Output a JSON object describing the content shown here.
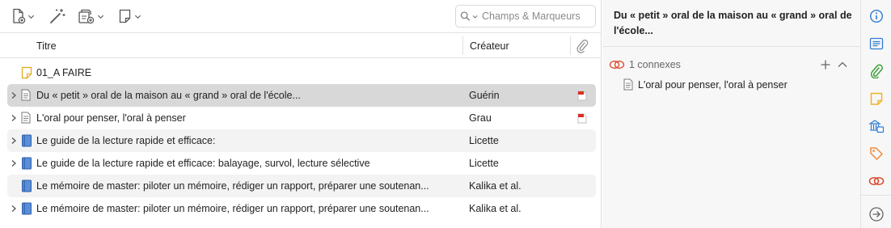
{
  "toolbar": {
    "new_item_icon": "new-item-icon",
    "magic_wand_icon": "add-by-identifier-icon",
    "attachment_icon": "add-attachment-icon",
    "note_icon": "new-note-icon",
    "search": {
      "placeholder": "Champs & Marqueurs",
      "value": ""
    }
  },
  "columns": {
    "title": "Titre",
    "creator": "Créateur",
    "attachment_icon": "paperclip-icon"
  },
  "rows": [
    {
      "title": "01_A FAIRE",
      "creator": "",
      "icon": "note-icon",
      "expandable": false,
      "pdf": false,
      "selected": false,
      "alt": false
    },
    {
      "title": "Du « petit » oral de la maison au « grand » oral de l'école...",
      "creator": "Guérin",
      "icon": "document-icon",
      "expandable": true,
      "pdf": true,
      "selected": true,
      "alt": false
    },
    {
      "title": "L'oral pour penser, l'oral à penser",
      "creator": "Grau",
      "icon": "document-icon",
      "expandable": true,
      "pdf": true,
      "selected": false,
      "alt": false
    },
    {
      "title": "Le guide de la lecture rapide et efficace:",
      "creator": "Licette",
      "icon": "book-icon",
      "expandable": true,
      "pdf": false,
      "selected": false,
      "alt": true
    },
    {
      "title": "Le guide de la lecture rapide et efficace: balayage, survol, lecture sélective",
      "creator": "Licette",
      "icon": "book-icon",
      "expandable": true,
      "pdf": false,
      "selected": false,
      "alt": false
    },
    {
      "title": "Le mémoire de master: piloter un mémoire, rédiger un rapport, préparer une soutenan...",
      "creator": "Kalika et al.",
      "icon": "book-icon",
      "expandable": false,
      "pdf": false,
      "selected": false,
      "alt": true
    },
    {
      "title": "Le mémoire de master: piloter un mémoire, rédiger un rapport, préparer une soutenan...",
      "creator": "Kalika et al.",
      "icon": "book-icon",
      "expandable": true,
      "pdf": false,
      "selected": false,
      "alt": false
    }
  ],
  "item_pane": {
    "title": "Du « petit » oral de la maison au « grand » oral de l'école...",
    "related": {
      "count_label": "1 connexes",
      "items": [
        {
          "title": "L'oral pour penser, l'oral à penser"
        }
      ]
    }
  },
  "sidebar": {
    "icons": [
      "info-icon",
      "abstract-icon",
      "attachments-icon",
      "notes-icon",
      "libraries-collections-icon",
      "tags-icon",
      "related-icon",
      "locate-icon"
    ]
  },
  "colors": {
    "accent_blue": "#2e7bd6",
    "attachment_green": "#3aa13a",
    "note_yellow": "#f0b429",
    "tag_orange": "#f08a3c",
    "related_red": "#d9472b",
    "pdf_red": "#d93025",
    "selected_row": "#d8d8d8"
  }
}
